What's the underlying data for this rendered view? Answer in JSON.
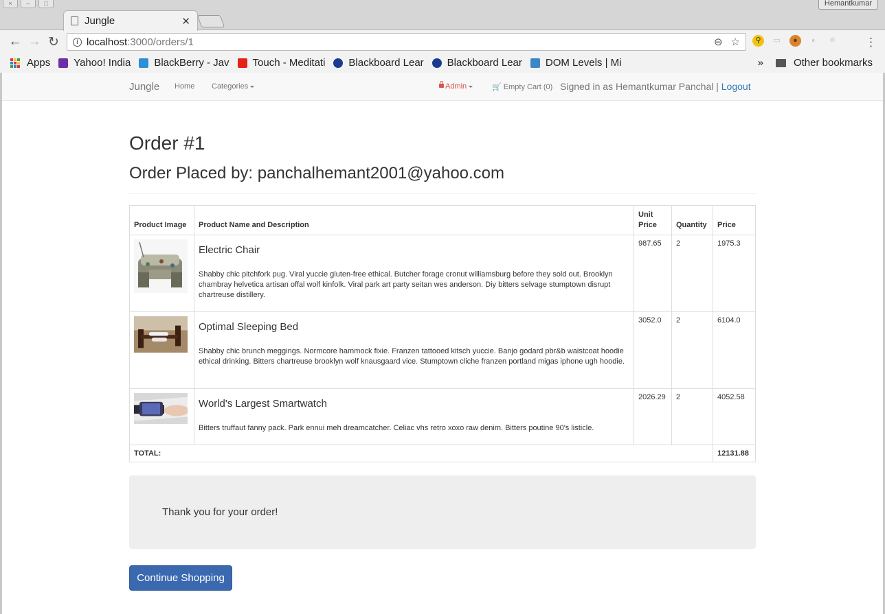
{
  "browser": {
    "profile_name": "Hemantkumar",
    "tab_title": "Jungle",
    "url_host": "localhost",
    "url_path": ":3000/orders/1",
    "bookmarks": [
      {
        "label": "Apps",
        "icon": "apps-grid-icon"
      },
      {
        "label": "Yahoo! India",
        "icon": "yahoo-icon",
        "color": "#6f2da8"
      },
      {
        "label": "BlackBerry - Jav",
        "icon": "blackberry-icon",
        "color": "#2d8fd5"
      },
      {
        "label": "Touch - Meditati",
        "icon": "youtube-icon",
        "color": "#e62117"
      },
      {
        "label": "Blackboard Lear",
        "icon": "blackboard-icon",
        "color": "#1a3c8f"
      },
      {
        "label": "Blackboard Lear",
        "icon": "blackboard-icon",
        "color": "#1a3c8f"
      },
      {
        "label": "DOM Levels | Mi",
        "icon": "mdn-icon",
        "color": "#3a87c8"
      }
    ],
    "other_bookmarks": "Other bookmarks",
    "overflow": "»"
  },
  "navbar": {
    "brand": "Jungle",
    "home": "Home",
    "categories": "Categories",
    "admin": "Admin",
    "cart": "Empty Cart (0)",
    "signed_in": "Signed in as Hemantkumar Panchal |",
    "logout": "Logout"
  },
  "order": {
    "title": "Order #1",
    "placed_by": "Order Placed by: panchalhemant2001@yahoo.com",
    "headers": {
      "image": "Product Image",
      "name": "Product Name and Description",
      "unit_price": "Unit Price",
      "quantity": "Quantity",
      "price": "Price"
    },
    "items": [
      {
        "name": "Electric Chair",
        "description": "Shabby chic pitchfork pug. Viral yuccie gluten-free ethical. Butcher forage cronut williamsburg before they sold out. Brooklyn chambray helvetica artisan offal wolf kinfolk. Viral park art party seitan wes anderson. Diy bitters selvage stumptown disrupt chartreuse distillery.",
        "unit_price": "987.65",
        "quantity": "2",
        "price": "1975.3"
      },
      {
        "name": "Optimal Sleeping Bed",
        "description": "Shabby chic brunch meggings. Normcore hammock fixie. Franzen tattooed kitsch yuccie. Banjo godard pbr&b waistcoat hoodie ethical drinking. Bitters chartreuse brooklyn wolf knausgaard vice. Stumptown cliche franzen portland migas iphone ugh hoodie.",
        "unit_price": "3052.0",
        "quantity": "2",
        "price": "6104.0"
      },
      {
        "name": "World's Largest Smartwatch",
        "description": "Bitters truffaut fanny pack. Park ennui meh dreamcatcher. Celiac vhs retro xoxo raw denim. Bitters poutine 90's listicle.",
        "unit_price": "2026.29",
        "quantity": "2",
        "price": "4052.58"
      }
    ],
    "total_label": "TOTAL:",
    "total_value": "12131.88"
  },
  "thanks": "Thank you for your order!",
  "continue_button": "Continue Shopping"
}
